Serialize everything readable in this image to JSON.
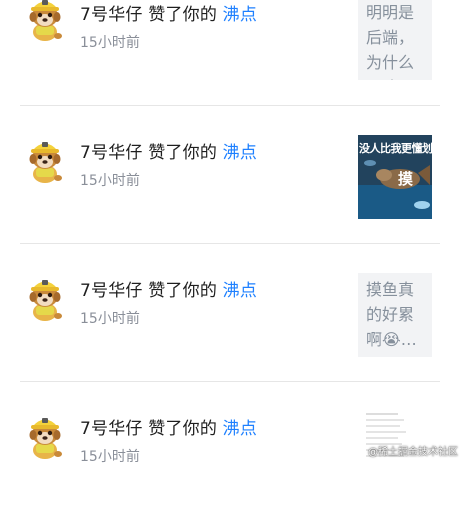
{
  "notifications": [
    {
      "actor": "7号华仔",
      "action": " 赞了你的 ",
      "target": "沸点",
      "time": "15小时前",
      "preview_text": "明明是后端，为什么要改…"
    },
    {
      "actor": "7号华仔",
      "action": " 赞了你的 ",
      "target": "沸点",
      "time": "15小时前",
      "preview_caption": "没人比我更懂划水",
      "preview_big": "摸"
    },
    {
      "actor": "7号华仔",
      "action": " 赞了你的 ",
      "target": "沸点",
      "time": "15小时前",
      "preview_text": "摸鱼真的好累啊",
      "preview_emoji": "😭…"
    },
    {
      "actor": "7号华仔",
      "action": " 赞了你的 ",
      "target": "沸点",
      "time": "15小时前"
    }
  ],
  "watermark": "@稀土掘金技术社区",
  "colors": {
    "link": "#1e80ff",
    "time": "#8a8f99",
    "divider": "#e6e6e6"
  },
  "icons": {
    "avatar": "paw-patrol-rubble-avatar"
  }
}
